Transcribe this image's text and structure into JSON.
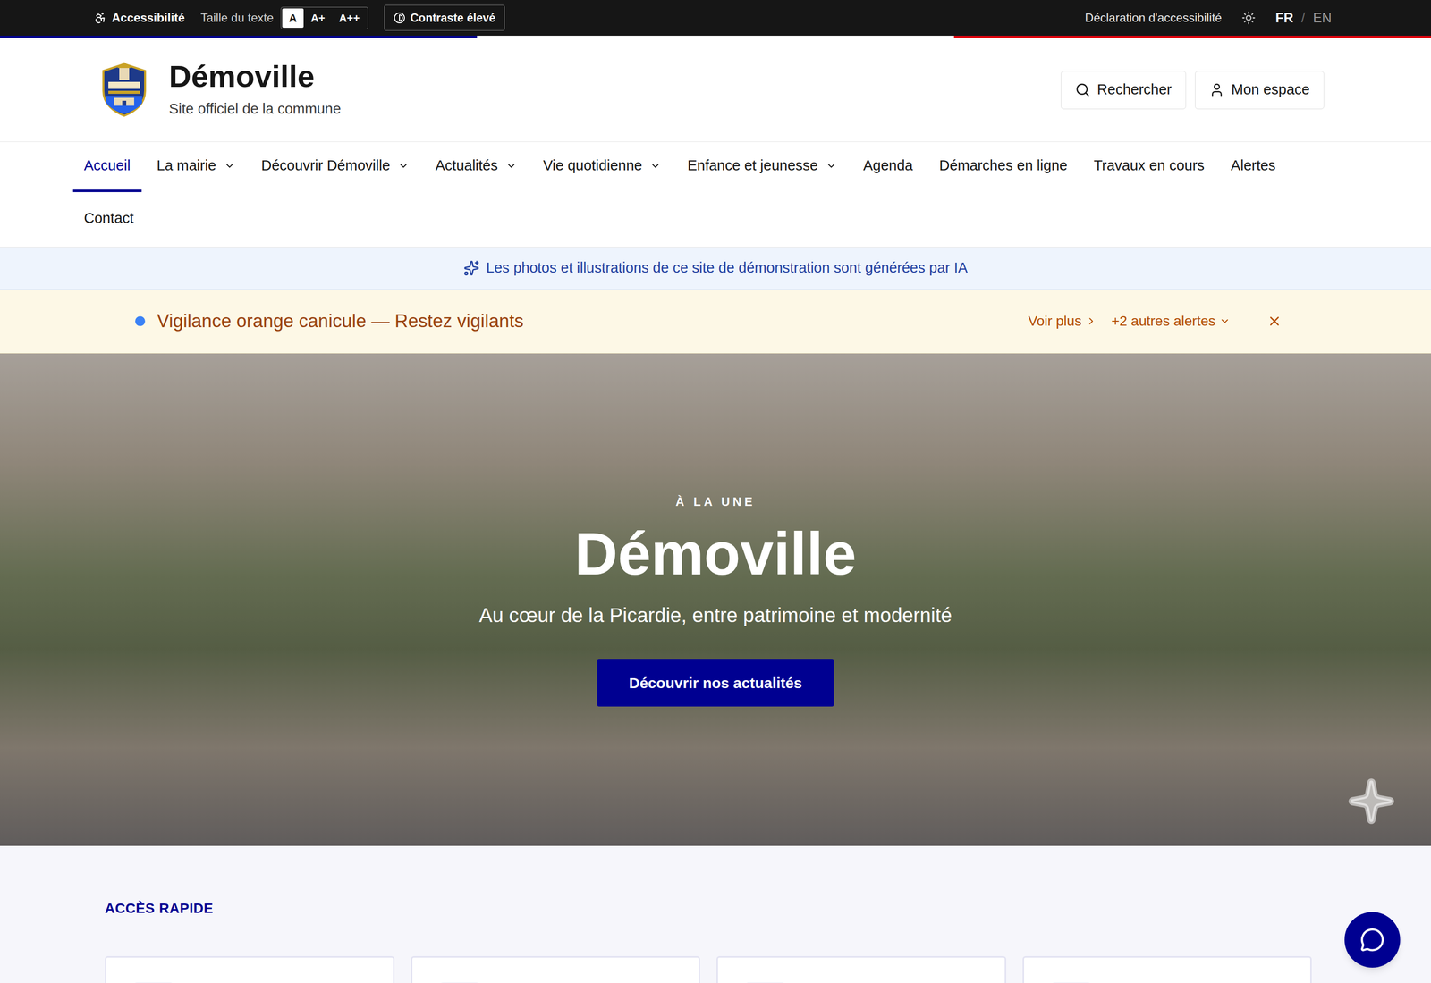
{
  "topbar": {
    "accessibility": "Accessibilité",
    "text_size_label": "Taille du texte",
    "text_sizes": [
      {
        "label": "A",
        "selected": true
      },
      {
        "label": "A+",
        "selected": false
      },
      {
        "label": "A++",
        "selected": false
      }
    ],
    "contrast": "Contraste élevé",
    "declaration": "Déclaration d'accessibilité",
    "languages": [
      {
        "label": "FR",
        "selected": true
      },
      {
        "label": "EN",
        "selected": false
      }
    ],
    "language_separator": "/"
  },
  "header": {
    "title": "Démoville",
    "subtitle": "Site officiel de la commune",
    "search": "Rechercher",
    "account": "Mon espace"
  },
  "nav": {
    "items": [
      {
        "label": "Accueil",
        "selected": true,
        "dropdown": false
      },
      {
        "label": "La mairie",
        "selected": false,
        "dropdown": true
      },
      {
        "label": "Découvrir Démoville",
        "selected": false,
        "dropdown": true
      },
      {
        "label": "Actualités",
        "selected": false,
        "dropdown": true
      },
      {
        "label": "Vie quotidienne",
        "selected": false,
        "dropdown": true
      },
      {
        "label": "Enfance et jeunesse",
        "selected": false,
        "dropdown": true
      },
      {
        "label": "Agenda",
        "selected": false,
        "dropdown": false
      },
      {
        "label": "Démarches en ligne",
        "selected": false,
        "dropdown": false
      },
      {
        "label": "Travaux en cours",
        "selected": false,
        "dropdown": false
      },
      {
        "label": "Alertes",
        "selected": false,
        "dropdown": false
      },
      {
        "label": "Contact",
        "selected": false,
        "dropdown": false
      }
    ]
  },
  "ai_notice": "Les photos et illustrations de ce site de démonstration sont générées par IA",
  "alert": {
    "message": "Vigilance orange canicule — Restez vigilants",
    "more": "Voir plus",
    "others": "+2 autres alertes"
  },
  "hero": {
    "kicker": "À LA UNE",
    "title": "Démoville",
    "subtitle": "Au cœur de la Picardie, entre patrimoine et modernité",
    "button": "Découvrir nos actualités"
  },
  "quick_access": {
    "title": "ACCÈS RAPIDE",
    "cards": [
      {},
      {},
      {},
      {}
    ]
  }
}
